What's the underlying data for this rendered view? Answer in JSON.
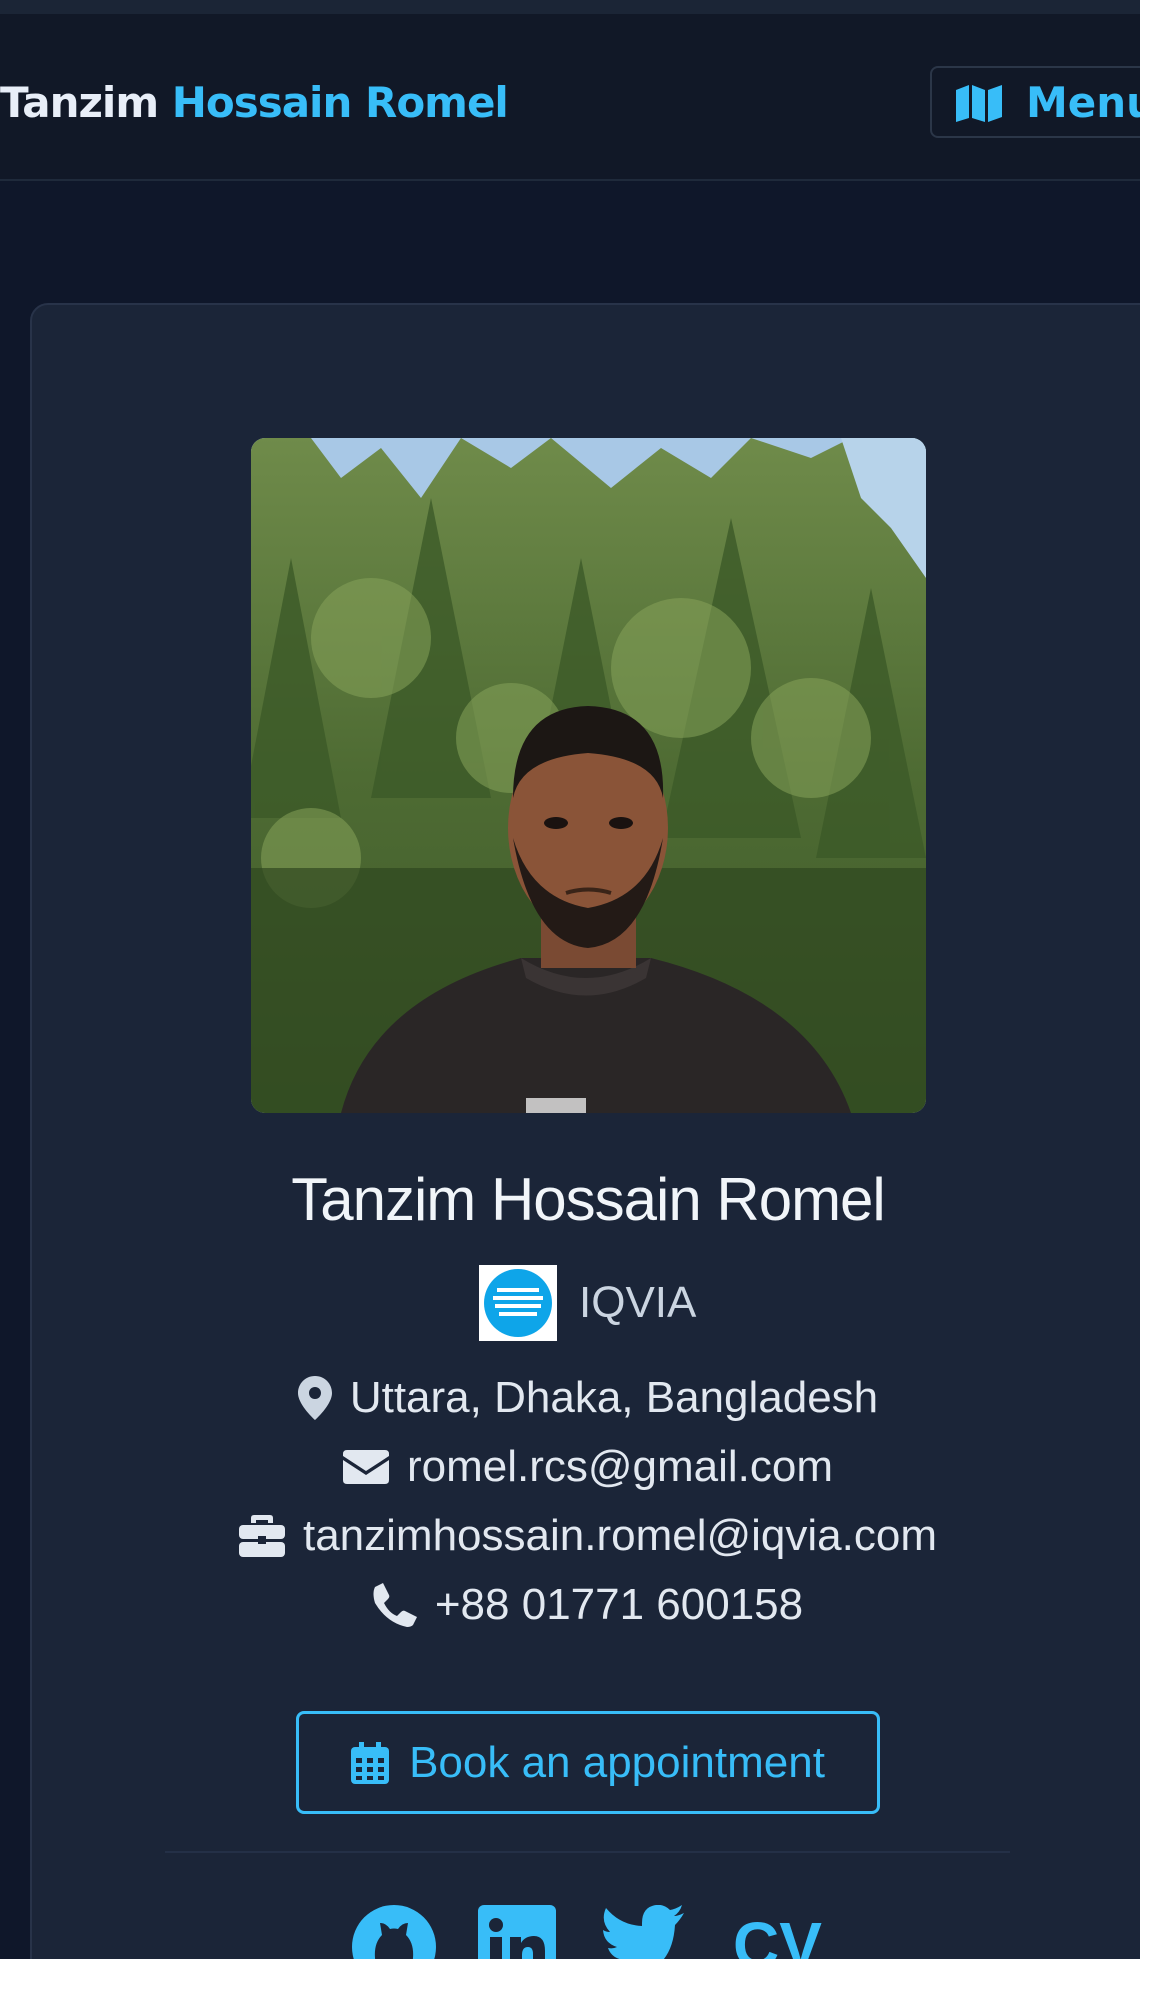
{
  "navbar": {
    "brand_first": "Tanzim",
    "brand_rest": " Hossain Romel",
    "menu_label": "Menu",
    "menu_icon": "map-icon"
  },
  "profile": {
    "photo_alt": "Profile photo",
    "name": "Tanzim Hossain Romel",
    "company": "IQVIA",
    "location": "Uttara, Dhaka, Bangladesh",
    "email": "romel.rcs@gmail.com",
    "work_email": "tanzimhossain.romel@iqvia.com",
    "phone": "+88 01771 600158"
  },
  "actions": {
    "appointment_label": "Book an appointment",
    "appointment_icon": "calendar-icon"
  },
  "social": {
    "icons": [
      "github-icon",
      "linkedin-icon",
      "twitter-icon"
    ],
    "cv_label": "CV"
  },
  "colors": {
    "accent": "#38bdf8",
    "background": "#0f172a",
    "card": "#1b2538"
  }
}
